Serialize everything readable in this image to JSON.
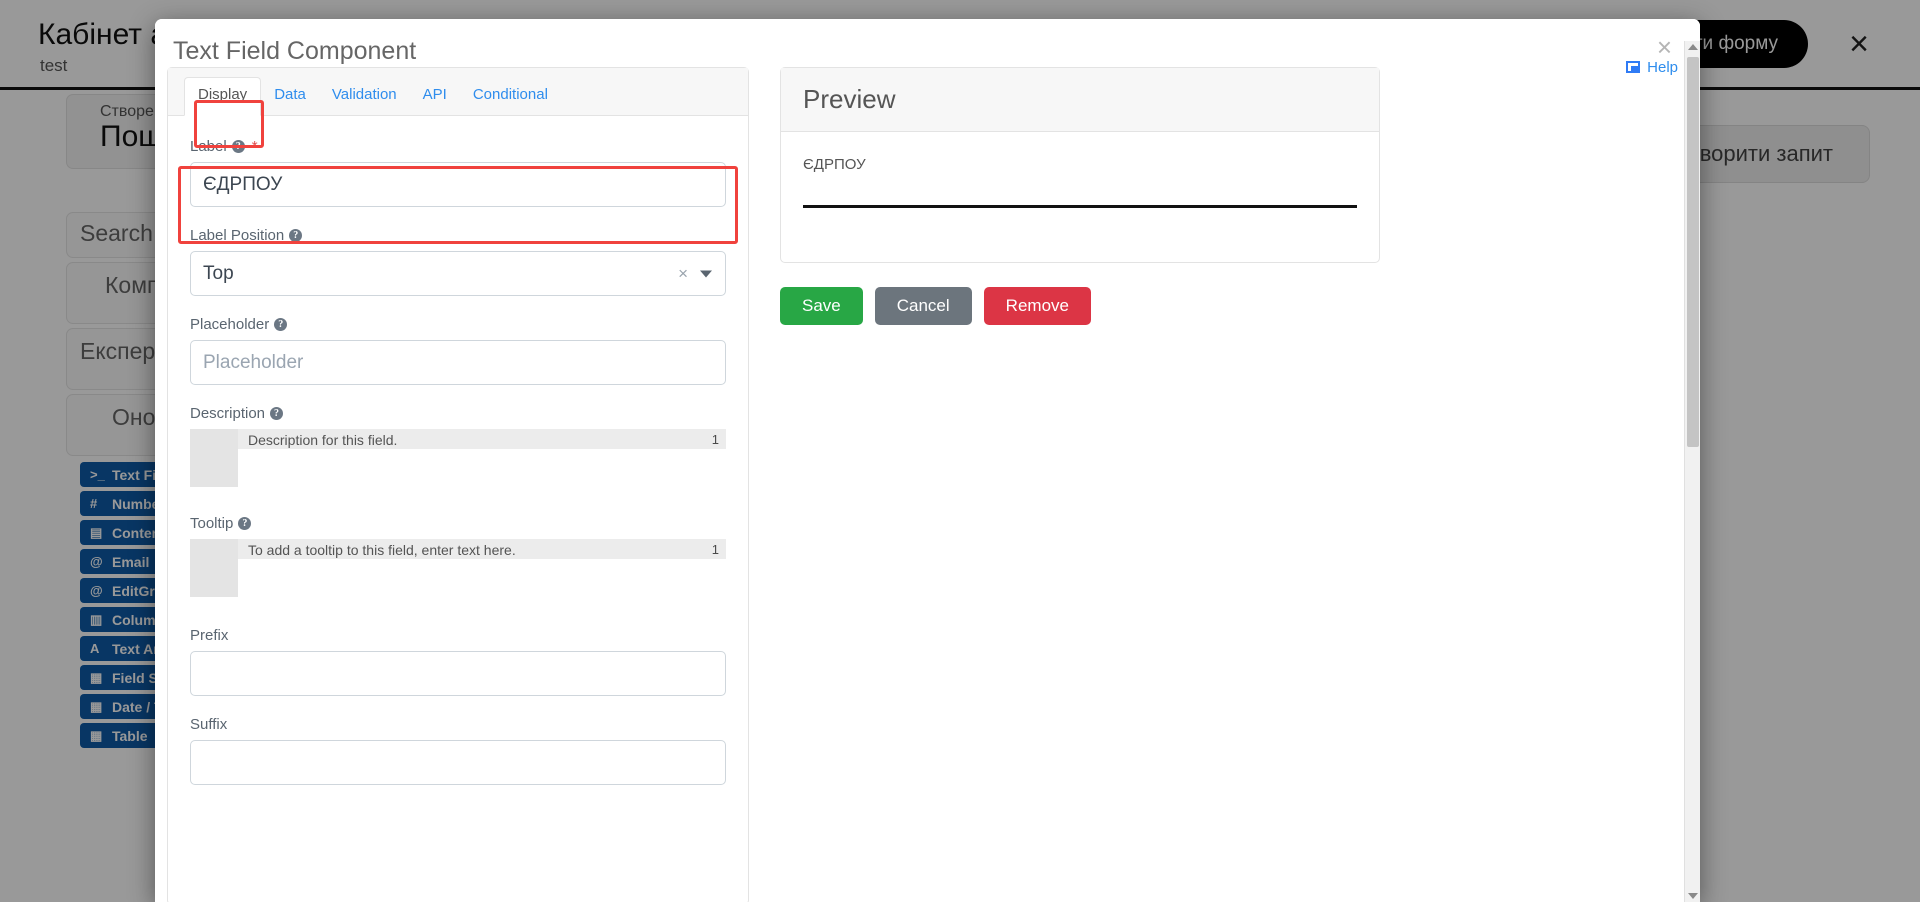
{
  "background": {
    "app_title": "Кабінет адміністратора",
    "app_subtitle": "test",
    "dark_button_label": "Зберегти форму",
    "close_icon": "close-icon",
    "form_meta_label": "Створення форми",
    "form_meta_value": "Пошук",
    "request_button_label": "Створити запит",
    "search_placeholder": "Search field(s)",
    "group_basic": "Компоненти",
    "group_experimental": "Експериментальні",
    "group_updated": "Оновлені",
    "components": [
      {
        "icon": ">_",
        "label": "Text Field"
      },
      {
        "icon": "#",
        "label": "Number"
      },
      {
        "icon": "▤",
        "label": "Content"
      },
      {
        "icon": "@",
        "label": "Email"
      },
      {
        "icon": "@",
        "label": "EditGrid"
      },
      {
        "icon": "▥",
        "label": "Columns"
      },
      {
        "icon": "A",
        "label": "Text Area"
      },
      {
        "icon": "▦",
        "label": "Field Set"
      },
      {
        "icon": "▦",
        "label": "Date / Time"
      },
      {
        "icon": "▦",
        "label": "Table"
      }
    ]
  },
  "modal": {
    "title": "Text Field Component",
    "close_icon": "close-icon",
    "help_label": "Help",
    "help_icon": "external-window-icon",
    "tabs": [
      {
        "id": "display",
        "label": "Display",
        "active": true
      },
      {
        "id": "data",
        "label": "Data",
        "active": false
      },
      {
        "id": "validation",
        "label": "Validation",
        "active": false
      },
      {
        "id": "api",
        "label": "API",
        "active": false
      },
      {
        "id": "conditional",
        "label": "Conditional",
        "active": false
      }
    ],
    "fields": {
      "label": {
        "label": "Label",
        "required_marker": "*",
        "value": "ЄДРПОУ",
        "placeholder": ""
      },
      "label_position": {
        "label": "Label Position",
        "value": "Top",
        "clear_icon": "×",
        "caret_icon": "chevron-down-icon"
      },
      "placeholder": {
        "label": "Placeholder",
        "value": "",
        "placeholder": "Placeholder"
      },
      "description": {
        "label": "Description",
        "line_number": "1",
        "value": "Description for this field."
      },
      "tooltip": {
        "label": "Tooltip",
        "line_number": "1",
        "value": "To add a tooltip to this field, enter text here."
      },
      "prefix": {
        "label": "Prefix",
        "value": ""
      },
      "suffix": {
        "label": "Suffix",
        "value": ""
      }
    },
    "preview": {
      "title": "Preview",
      "field_label": "ЄДРПОУ",
      "buttons": {
        "save": "Save",
        "cancel": "Cancel",
        "remove": "Remove"
      }
    }
  },
  "colors": {
    "save": "#28a745",
    "cancel": "#6c757d",
    "remove": "#dc3545",
    "highlight": "#f0423d",
    "link": "#2f8ded",
    "component_blue": "#0e5aa7"
  }
}
